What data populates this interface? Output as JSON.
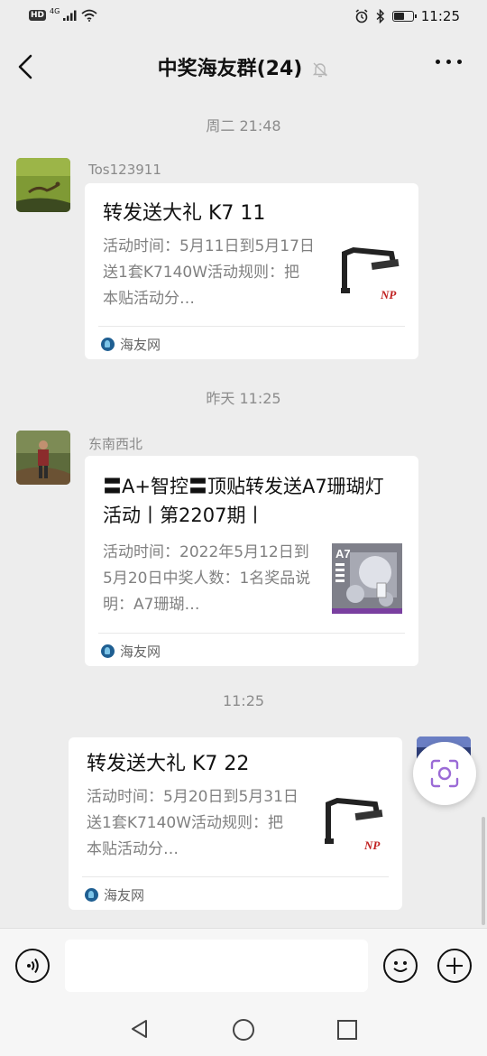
{
  "status_bar": {
    "network_badge": "HD",
    "network_type": "4G",
    "time": "11:25",
    "battery_level": 0.6
  },
  "header": {
    "title": "中奖海友群(24)",
    "icons": [
      "back-icon",
      "mute-bell-icon",
      "more-icon"
    ]
  },
  "messages": [
    {
      "timestamp": "周二 21:48",
      "sender": "Tos123911",
      "card": {
        "title": "转发送大礼 K7 11",
        "description": "活动时间：5月11日到5月17日送1套K7140W活动规则：把本贴活动分…",
        "thumb_label": "NP",
        "source": "海友网"
      }
    },
    {
      "timestamp": "昨天 11:25",
      "sender": "东南西北",
      "card": {
        "title": "〓A+智控〓顶贴转发送A7珊瑚灯活动丨第2207期丨",
        "description": "活动时间：2022年5月12日到5月20日中奖人数：1名奖品说明：A7珊瑚…",
        "thumb_label": "A7",
        "source": "海友网"
      }
    },
    {
      "timestamp": "11:25",
      "sender": "",
      "card": {
        "title": "转发送大礼 K7 22",
        "description": "活动时间：5月20日到5月31日送1套K7140W活动规则：把本贴活动分…",
        "thumb_label": "NP",
        "source": "海友网"
      }
    }
  ],
  "input_bar": {
    "placeholder": "",
    "icons": [
      "voice-icon",
      "emoji-icon",
      "plus-icon"
    ]
  },
  "floating": {
    "icon": "scan-lens-icon",
    "accent": "#9b6bd6"
  },
  "nav_bar": {
    "icons": [
      "nav-back-icon",
      "nav-home-icon",
      "nav-recent-icon"
    ]
  }
}
